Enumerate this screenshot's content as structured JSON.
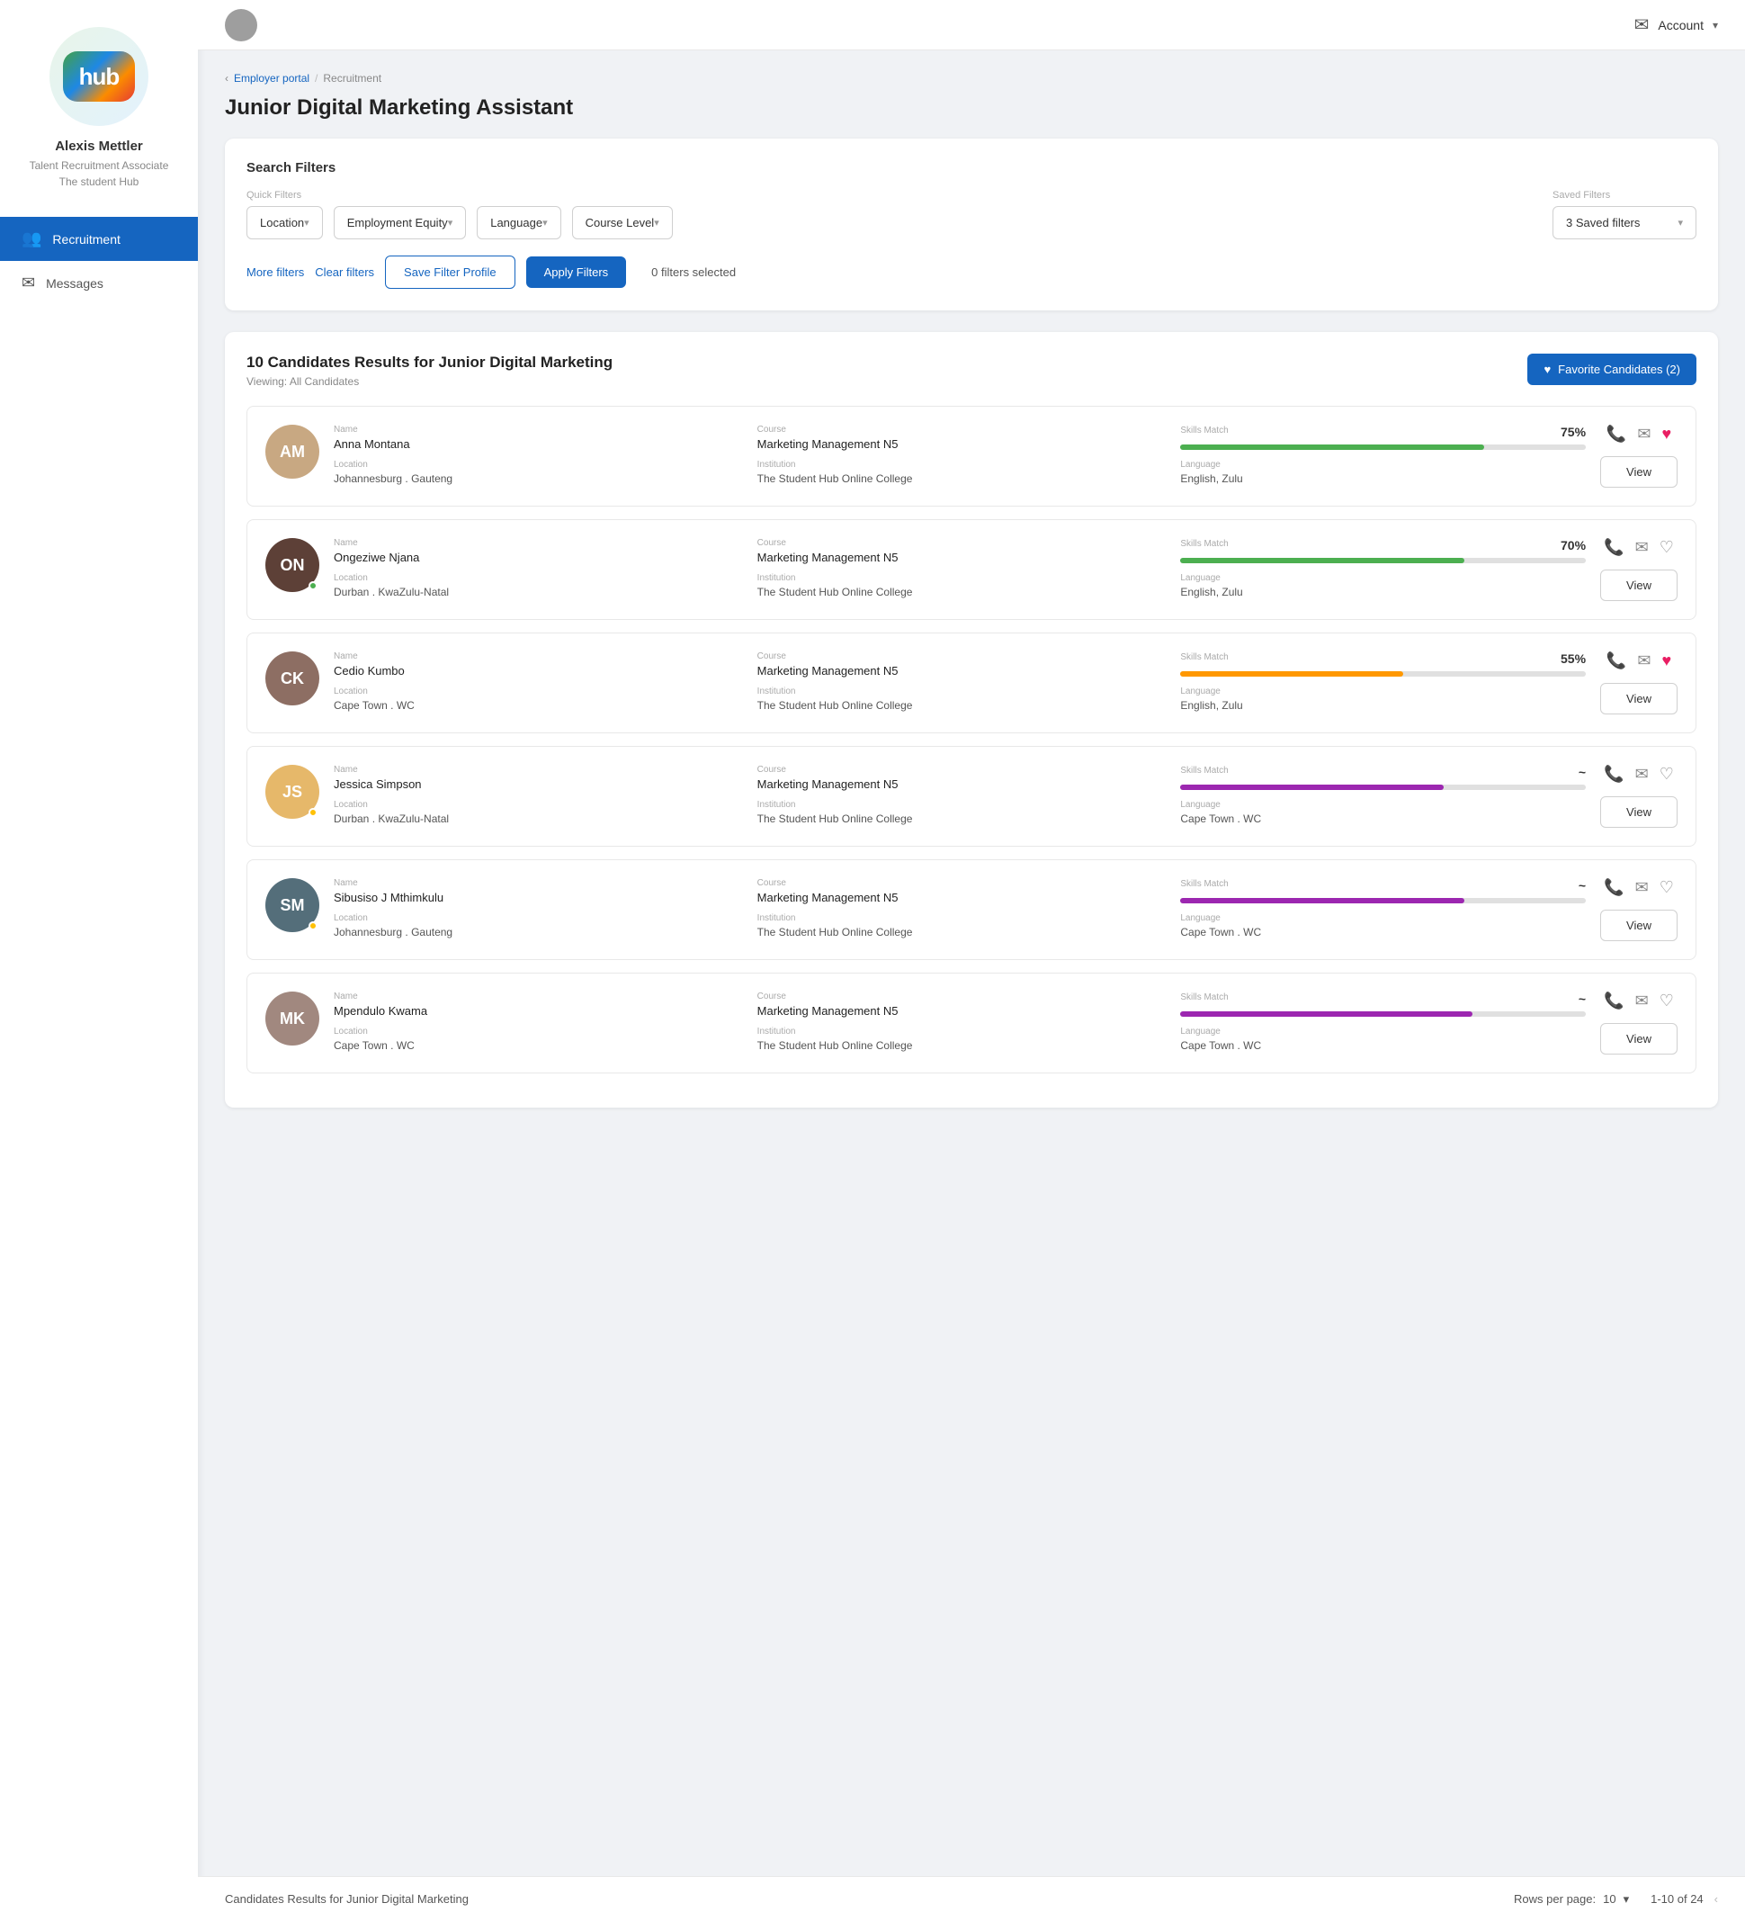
{
  "sidebar": {
    "user_name": "Alexis Mettler",
    "user_role": "Talent Recruitment Associate",
    "user_sub": "The student Hub",
    "hub_text": "hub",
    "nav_items": [
      {
        "id": "recruitment",
        "label": "Recruitment",
        "icon": "👥",
        "active": true
      },
      {
        "id": "messages",
        "label": "Messages",
        "icon": "✉",
        "active": false
      }
    ]
  },
  "topbar": {
    "account_label": "Account",
    "chevron": "▾"
  },
  "breadcrumb": {
    "portal": "Employer portal",
    "sep": "/",
    "current": "Recruitment"
  },
  "page": {
    "title": "Junior Digital Marketing Assistant"
  },
  "filters": {
    "section_title": "Search Filters",
    "quick_filters_label": "Quick Filters",
    "saved_filters_label": "Saved Filters",
    "location_label": "Location",
    "employment_equity_label": "Employment Equity",
    "language_label": "Language",
    "course_level_label": "Course Level",
    "saved_filters_value": "3 Saved filters",
    "more_filters": "More filters",
    "clear_filters": "Clear filters",
    "save_filter": "Save Filter Profile",
    "apply_filters": "Apply Filters",
    "filters_selected": "0 filters selected"
  },
  "results": {
    "count": "10",
    "title": "Candidates Results for Junior Digital Marketing",
    "viewing": "Viewing: All Candidates",
    "favorites_btn": "Favorite Candidates (2)",
    "candidates": [
      {
        "id": 1,
        "name": "Anna Montana",
        "course_label": "Course",
        "course": "Marketing Management N5",
        "location_label": "Location",
        "location": "Johannesburg . Gauteng",
        "institution_label": "Institution",
        "institution": "The Student Hub Online College",
        "language_label": "Language",
        "language": "English, Zulu",
        "skills_label": "Skills Match",
        "skills_pct": "75%",
        "skills_fill": 75,
        "skills_color": "green",
        "favorited": true,
        "avatar_type": "image",
        "avatar_bg": "#c8a882",
        "avatar_initials": "AM"
      },
      {
        "id": 2,
        "name": "Ongeziwe Njana",
        "course_label": "Course",
        "course": "Marketing Management N5",
        "location_label": "Location",
        "location": "Durban . KwaZulu-Natal",
        "institution_label": "Institution",
        "institution": "The Student Hub Online College",
        "language_label": "Language",
        "language": "English, Zulu",
        "skills_label": "Skills Match",
        "skills_pct": "70%",
        "skills_fill": 70,
        "skills_color": "green",
        "favorited": false,
        "avatar_type": "image",
        "avatar_bg": "#5d4037",
        "avatar_initials": "ON"
      },
      {
        "id": 3,
        "name": "Cedio Kumbo",
        "course_label": "Course",
        "course": "Marketing Management N5",
        "location_label": "Location",
        "location": "Cape Town . WC",
        "institution_label": "Institution",
        "institution": "The Student Hub Online College",
        "language_label": "Language",
        "language": "English, Zulu",
        "skills_label": "Skills Match",
        "skills_pct": "55%",
        "skills_fill": 55,
        "skills_color": "orange",
        "favorited": true,
        "avatar_type": "image",
        "avatar_bg": "#8d6e63",
        "avatar_initials": "CK"
      },
      {
        "id": 4,
        "name": "Jessica Simpson",
        "course_label": "Course",
        "course": "Marketing Management N5",
        "location_label": "Location",
        "location": "Durban . KwaZulu-Natal",
        "institution_label": "Institution",
        "institution": "The Student Hub Online College",
        "language_label": "Language",
        "language": "Cape Town . WC",
        "skills_label": "Skills Match",
        "skills_pct": "~",
        "skills_fill": 65,
        "skills_color": "purple",
        "favorited": false,
        "avatar_type": "image",
        "avatar_bg": "#e6b86a",
        "avatar_initials": "JS"
      },
      {
        "id": 5,
        "name": "Sibusiso J Mthimkulu",
        "course_label": "Course",
        "course": "Marketing Management N5",
        "location_label": "Location",
        "location": "Johannesburg . Gauteng",
        "institution_label": "Institution",
        "institution": "The Student Hub Online College",
        "language_label": "Language",
        "language": "Cape Town . WC",
        "skills_label": "Skills Match",
        "skills_pct": "~",
        "skills_fill": 70,
        "skills_color": "purple",
        "favorited": false,
        "avatar_type": "initials",
        "avatar_bg": "#546e7a",
        "avatar_initials": "SM"
      },
      {
        "id": 6,
        "name": "Mpendulo Kwama",
        "course_label": "Course",
        "course": "Marketing Management N5",
        "location_label": "Location",
        "location": "Cape Town . WC",
        "institution_label": "Institution",
        "institution": "The Student Hub Online College",
        "language_label": "Language",
        "language": "Cape Town . WC",
        "skills_label": "Skills Match",
        "skills_pct": "~",
        "skills_fill": 72,
        "skills_color": "purple",
        "favorited": false,
        "avatar_type": "image",
        "avatar_bg": "#a1887f",
        "avatar_initials": "MK"
      }
    ]
  },
  "footer": {
    "results_label": "Candidates Results for Junior Digital Marketing",
    "rows_per_page": "Rows per page:",
    "rows_count": "10",
    "pagination": "1-10 of 24"
  }
}
